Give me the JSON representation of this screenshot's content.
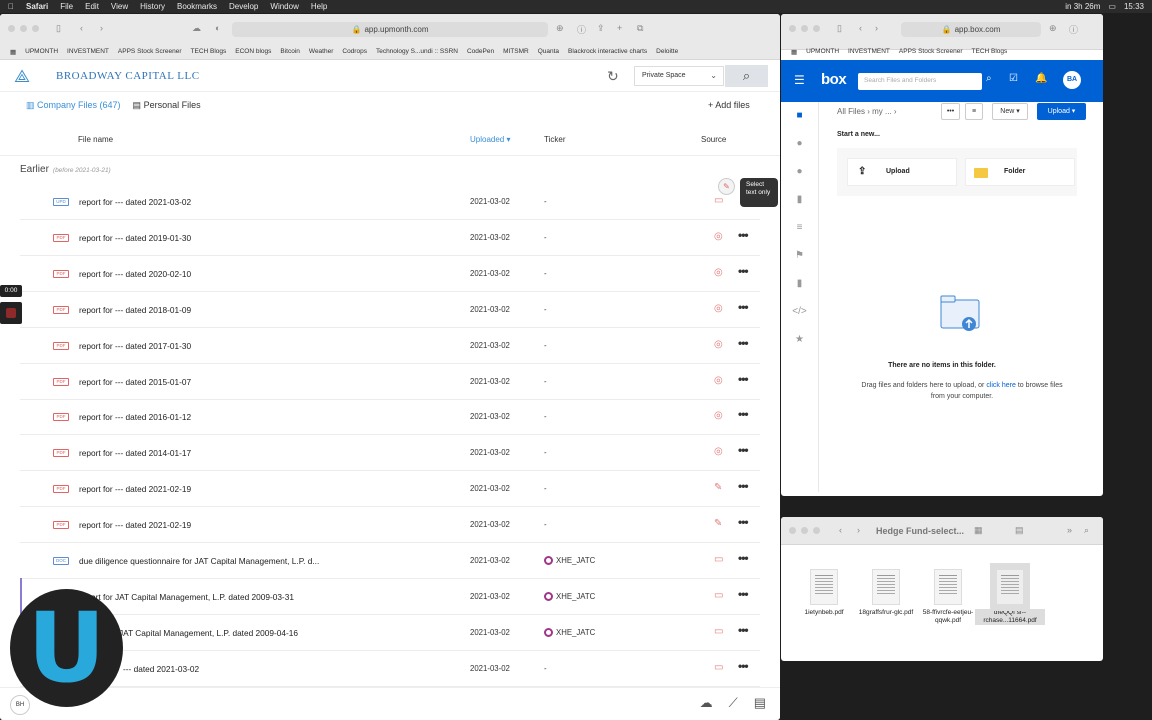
{
  "menubar": {
    "app": "Safari",
    "items": [
      "File",
      "Edit",
      "View",
      "History",
      "Bookmarks",
      "Develop",
      "Window",
      "Help"
    ],
    "battery_text": "in 3h 26m",
    "clock": "15:33"
  },
  "left_browser": {
    "url": "app.upmonth.com",
    "bookmarks": [
      "UPMONTH",
      "INVESTMENT",
      "APPS Stock Screener",
      "TECH Blogs",
      "ECON blogs",
      "Bitcoin",
      "Weather",
      "Codrops",
      "Technology S...undi :: SSRN",
      "CodePen",
      "MITSMR",
      "Quanta",
      "Blackrock interactive charts",
      "Deloitte"
    ],
    "company": "BROADWAY CAPITAL LLC",
    "space_select": "Private Space",
    "tabs": {
      "company_files": "Company Files (647)",
      "personal_files": "Personal Files"
    },
    "add_files": "Add files",
    "columns": {
      "file_name": "File name",
      "uploaded": "Uploaded ▾",
      "ticker": "Ticker",
      "source": "Source"
    },
    "group_label": "Earlier",
    "group_note": "(before 2021-03-21)",
    "tooltip": "Select text only",
    "timer": "0:00",
    "footer_avatar": "BH",
    "rows": [
      {
        "type": "UPD",
        "name": "report for --- dated 2021-03-02",
        "date": "2021-03-02",
        "ticker": "-"
      },
      {
        "type": "PDF",
        "name": "report for --- dated 2019-01-30",
        "date": "2021-03-02",
        "ticker": "-"
      },
      {
        "type": "PDF",
        "name": "report for --- dated 2020-02-10",
        "date": "2021-03-02",
        "ticker": "-"
      },
      {
        "type": "PDF",
        "name": "report for --- dated 2018-01-09",
        "date": "2021-03-02",
        "ticker": "-"
      },
      {
        "type": "PDF",
        "name": "report for --- dated 2017-01-30",
        "date": "2021-03-02",
        "ticker": "-"
      },
      {
        "type": "PDF",
        "name": "report for --- dated 2015-01-07",
        "date": "2021-03-02",
        "ticker": "-"
      },
      {
        "type": "PDF",
        "name": "report for --- dated 2016-01-12",
        "date": "2021-03-02",
        "ticker": "-"
      },
      {
        "type": "PDF",
        "name": "report for --- dated 2014-01-17",
        "date": "2021-03-02",
        "ticker": "-"
      },
      {
        "type": "PDF",
        "name": "report for --- dated 2021-02-19",
        "date": "2021-03-02",
        "ticker": "-"
      },
      {
        "type": "PDF",
        "name": "report for --- dated 2021-02-19",
        "date": "2021-03-02",
        "ticker": "-"
      },
      {
        "type": "DOC",
        "name": "due diligence questionnaire for JAT Capital Management, L.P. d...",
        "date": "2021-03-02",
        "ticker": "XHE_JATC"
      },
      {
        "type": "PDF",
        "name": "report for JAT Capital Management, L.P. dated 2009-03-31",
        "date": "2021-03-02",
        "ticker": "XHE_JATC"
      },
      {
        "type": "PDF",
        "name": "JAT Capital Management, L.P. dated 2009-04-16",
        "date": "2021-03-02",
        "ticker": "XHE_JATC"
      },
      {
        "type": "PDF",
        "name": "--- dated 2021-03-02",
        "date": "2021-03-02",
        "ticker": "-"
      }
    ]
  },
  "box_window": {
    "url": "app.box.com",
    "bookmarks": [
      "UPMONTH",
      "INVESTMENT",
      "APPS Stock Screener",
      "TECH Blogs"
    ],
    "search_placeholder": "Search Files and Folders",
    "avatar": "BA",
    "breadcrumb": "All Files  ›  my ...  ›",
    "new_button": "New ▾",
    "upload_button": "Upload ▾",
    "start_new": "Start a new...",
    "card_upload": "Upload",
    "card_folder": "Folder",
    "empty_title": "There are no items in this folder.",
    "empty_text_a": "Drag files and folders here to upload, or",
    "empty_link": "click here",
    "empty_text_b": "to browse files from your computer."
  },
  "finder": {
    "title": "Hedge Fund-select...",
    "files": [
      {
        "name": "1ietynbeb.pdf"
      },
      {
        "name": "18graffsfrur-glc.pdf"
      },
      {
        "name": "58-ffivrcfe-eetjeu-qqwk.pdf"
      },
      {
        "name": "dfeQQf sf--rchase...11664.pdf"
      }
    ]
  }
}
